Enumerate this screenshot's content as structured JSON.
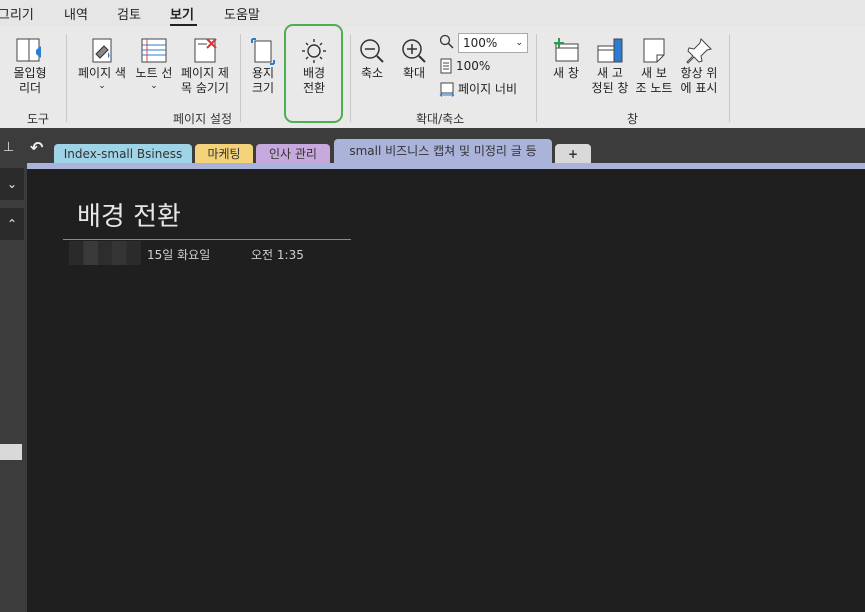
{
  "menu": {
    "items": [
      "그리기",
      "내역",
      "검토",
      "보기",
      "도움말"
    ]
  },
  "ribbon": {
    "immersive_reader": "몰입형\n리더",
    "page_color": "페이지 색",
    "rule_lines": "노트 선",
    "hide_page_title": "페이지 제\n목 숨기기",
    "paper_size": "용지\n크기",
    "switch_background": "배경\n전환",
    "zoom_out": "축소",
    "zoom_in": "확대",
    "zoom_value": "100%",
    "zoom_100": "100%",
    "page_width": "페이지 너비",
    "new_window": "새 창",
    "new_docked_window": "새 고\n정된 창",
    "new_side_note": "새 보\n조 노트",
    "always_on_top": "항상 위\n에 표시",
    "groups": {
      "tools": "도구",
      "page_setup": "페이지 설정",
      "zoom": "확대/축소",
      "window": "창"
    }
  },
  "sidebar": {
    "undo": "↶"
  },
  "tabs": [
    {
      "label": "Index-small Bsiness",
      "color": "#9fd3e6"
    },
    {
      "label": "마케팅",
      "color": "#f3d27a"
    },
    {
      "label": "인사 관리",
      "color": "#c7a9dd"
    },
    {
      "label": "small 비즈니스 캡쳐 및 미정리 글 등",
      "color": "#aab3d9"
    },
    {
      "label": "+",
      "color": "#d9d9d9"
    }
  ],
  "page": {
    "title": "배경 전환",
    "date": "15일 화요일",
    "time": "오전 1:35"
  },
  "colors": {
    "highlight": "#4caf50",
    "active_tab": "#aab3d9"
  }
}
